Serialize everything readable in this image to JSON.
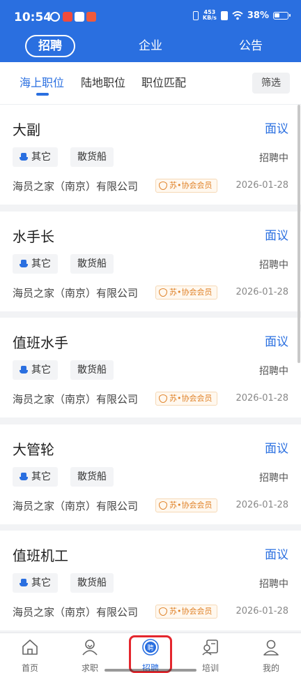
{
  "status_bar": {
    "time": "10:54",
    "net_speed_value": "453",
    "net_speed_unit": "KB/s",
    "battery": "38%"
  },
  "top_nav": {
    "tabs": [
      {
        "label": "招聘",
        "active": true
      },
      {
        "label": "企业",
        "active": false
      },
      {
        "label": "公告",
        "active": false
      }
    ]
  },
  "sub_nav": {
    "tabs": [
      {
        "label": "海上职位",
        "active": true
      },
      {
        "label": "陆地职位",
        "active": false
      },
      {
        "label": "职位匹配",
        "active": false
      }
    ],
    "filter_label": "筛选"
  },
  "jobs": [
    {
      "title": "大副",
      "salary": "面议",
      "tags": [
        "其它",
        "散货船"
      ],
      "status": "招聘中",
      "company": "海员之家（南京）有限公司",
      "badge": "苏•协会会员",
      "date": "2026-01-28"
    },
    {
      "title": "水手长",
      "salary": "面议",
      "tags": [
        "其它",
        "散货船"
      ],
      "status": "招聘中",
      "company": "海员之家（南京）有限公司",
      "badge": "苏•协会会员",
      "date": "2026-01-28"
    },
    {
      "title": "值班水手",
      "salary": "面议",
      "tags": [
        "其它",
        "散货船"
      ],
      "status": "招聘中",
      "company": "海员之家（南京）有限公司",
      "badge": "苏•协会会员",
      "date": "2026-01-28"
    },
    {
      "title": "大管轮",
      "salary": "面议",
      "tags": [
        "其它",
        "散货船"
      ],
      "status": "招聘中",
      "company": "海员之家（南京）有限公司",
      "badge": "苏•协会会员",
      "date": "2026-01-28"
    },
    {
      "title": "值班机工",
      "salary": "面议",
      "tags": [
        "其它",
        "散货船"
      ],
      "status": "招聘中",
      "company": "海员之家（南京）有限公司",
      "badge": "苏•协会会员",
      "date": "2026-01-28"
    }
  ],
  "tab_bar": {
    "items": [
      {
        "label": "首页",
        "icon": "home-icon"
      },
      {
        "label": "求职",
        "icon": "job-seek-icon"
      },
      {
        "label": "招聘",
        "icon": "recruit-icon",
        "icon_char": "聘",
        "active": true
      },
      {
        "label": "培训",
        "icon": "training-icon"
      },
      {
        "label": "我的",
        "icon": "profile-icon"
      }
    ]
  },
  "colors": {
    "primary": "#2a6fe0",
    "badge_orange": "#e0832a",
    "highlight_red": "#e4262d"
  }
}
